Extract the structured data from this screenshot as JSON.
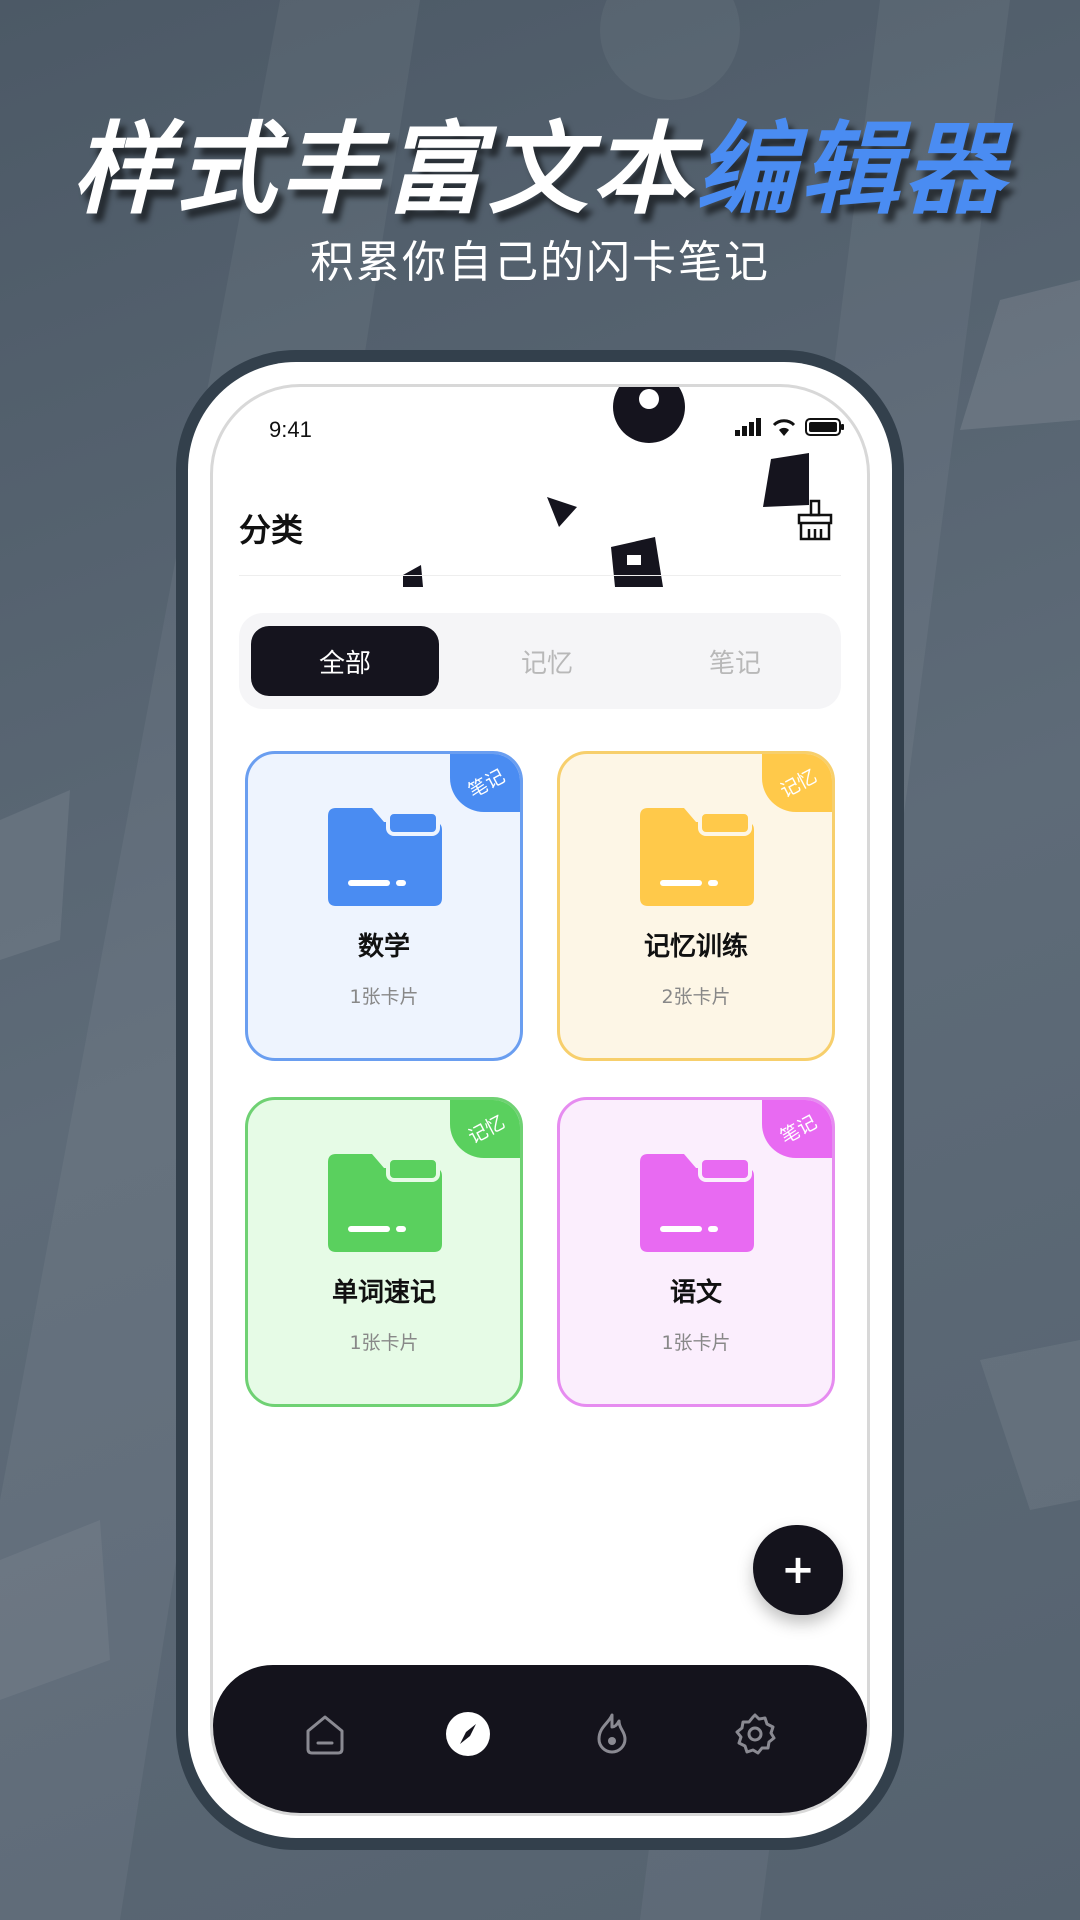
{
  "headline": {
    "part1": "样式丰富文本",
    "part2": "编辑器"
  },
  "subhead": "积累你自己的闪卡笔记",
  "status_bar": {
    "time": "9:41"
  },
  "header": {
    "title": "分类",
    "clean_icon": "broom-icon"
  },
  "segments": [
    {
      "label": "全部",
      "active": true
    },
    {
      "label": "记忆",
      "active": false
    },
    {
      "label": "笔记",
      "active": false
    }
  ],
  "categories": [
    {
      "title": "数学",
      "count": "1张卡片",
      "badge": "笔记",
      "accent": "#4a8cf2",
      "bg": "#eef4fe",
      "border": "#6a9ef0"
    },
    {
      "title": "记忆训练",
      "count": "2张卡片",
      "badge": "记忆",
      "accent": "#ffc94a",
      "bg": "#fdf6e6",
      "border": "#f7cf6c"
    },
    {
      "title": "单词速记",
      "count": "1张卡片",
      "badge": "记忆",
      "accent": "#5ad05e",
      "bg": "#e6fbe6",
      "border": "#6fd173"
    },
    {
      "title": "语文",
      "count": "1张卡片",
      "badge": "笔记",
      "accent": "#e86af2",
      "bg": "#fbeefd",
      "border": "#e68cf0"
    }
  ],
  "fab": {
    "label": "+"
  },
  "tabbar": [
    {
      "icon": "home-icon",
      "active": false
    },
    {
      "icon": "compass-icon",
      "active": true
    },
    {
      "icon": "flame-icon",
      "active": false
    },
    {
      "icon": "gear-icon",
      "active": false
    }
  ]
}
